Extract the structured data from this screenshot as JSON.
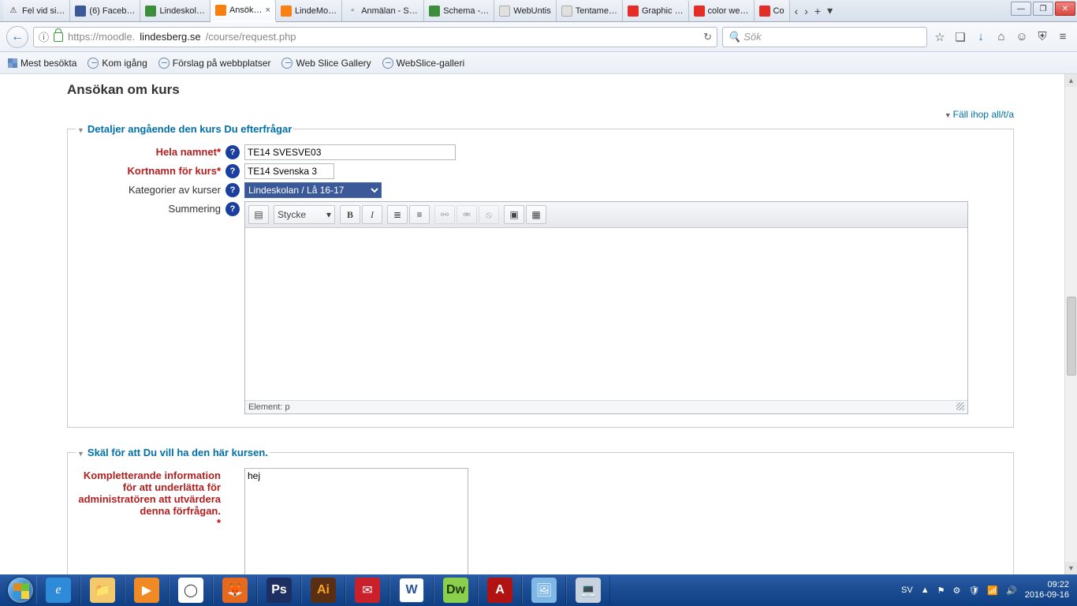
{
  "tabs": [
    {
      "label": "Fel vid si…",
      "icon": "warn"
    },
    {
      "label": "(6) Faceb…",
      "icon": "fb"
    },
    {
      "label": "Lindeskol…",
      "icon": "gn"
    },
    {
      "label": "Ansök…",
      "icon": "mo",
      "active": true,
      "close": "×"
    },
    {
      "label": "LindeMo…",
      "icon": "mo"
    },
    {
      "label": "Anmälan - Sit…",
      "icon": "gy"
    },
    {
      "label": "Schema -…",
      "icon": "gn"
    },
    {
      "label": "WebUntis",
      "icon": "wu"
    },
    {
      "label": "Tentame…",
      "icon": "wu"
    },
    {
      "label": "Graphic …",
      "icon": "yt"
    },
    {
      "label": "color we…",
      "icon": "yt"
    },
    {
      "label": "Co",
      "icon": "yt"
    }
  ],
  "tabctrl": {
    "left": "‹",
    "right": "›",
    "plus": "+",
    "menu": "▾"
  },
  "win": {
    "min": "—",
    "max": "❐",
    "close": "✕"
  },
  "nav": {
    "back": "←",
    "url_scheme_icon": "ⓘ",
    "url_host": "https://moodle.",
    "url_bold": "lindesberg.se",
    "url_path": "/course/request.php",
    "reload": "↻",
    "search_placeholder": "Sök",
    "search_icon": "🔍",
    "icons": [
      "☆",
      "❏",
      "↓",
      "⌂",
      "☺",
      "⛨",
      "≡"
    ]
  },
  "bm": [
    {
      "label": "Mest besökta",
      "icon": "grid"
    },
    {
      "label": "Kom igång"
    },
    {
      "label": "Förslag på webbplatser"
    },
    {
      "label": "Web Slice Gallery"
    },
    {
      "label": "WebSlice-galleri"
    }
  ],
  "page": {
    "heading": "Ansökan om kurs",
    "collapse_tri": "▼",
    "collapse_label": "Fäll ihop all/t/a",
    "sec1_legend": "Detaljer angående den kurs Du efterfrågar",
    "sec2_legend": "Skäl för att Du vill ha den här kursen.",
    "tri": "▼",
    "labels": {
      "fullname": "Hela namnet",
      "shortname": "Kortnamn för kurs",
      "category": "Kategorier av kurser",
      "summary": "Summering",
      "reason": "Kompletterande information för att underlätta för administratören att utvärdera denna förfrågan."
    },
    "ast": "*",
    "help": "?",
    "values": {
      "fullname": "TE14 SVESVE03",
      "shortname": "TE14 Svenska 3",
      "category": "Lindeskolan / Lå 16-17",
      "reason": "hej"
    },
    "editor": {
      "expand": "▤",
      "style": "Stycke",
      "style_arrow": "▾",
      "bold": "B",
      "italic": "I",
      "ul": "≣",
      "ol": "≡",
      "link": "⚯",
      "unlink": "⚮",
      "nolink": "⦸",
      "img": "▣",
      "media": "▦",
      "status": "Element: p"
    }
  },
  "taskbar": {
    "apps": [
      "e",
      "📁",
      "▶",
      "◯",
      "🦊",
      "Ps",
      "Ai",
      "✉",
      "W",
      "Dw",
      "A",
      "🖼",
      "💻"
    ],
    "lang": "SV",
    "tray_icons": [
      "▲",
      "⚑",
      "⚙",
      "🛡",
      "📶",
      "🔊"
    ],
    "time": "09:22",
    "date": "2016-09-16"
  }
}
